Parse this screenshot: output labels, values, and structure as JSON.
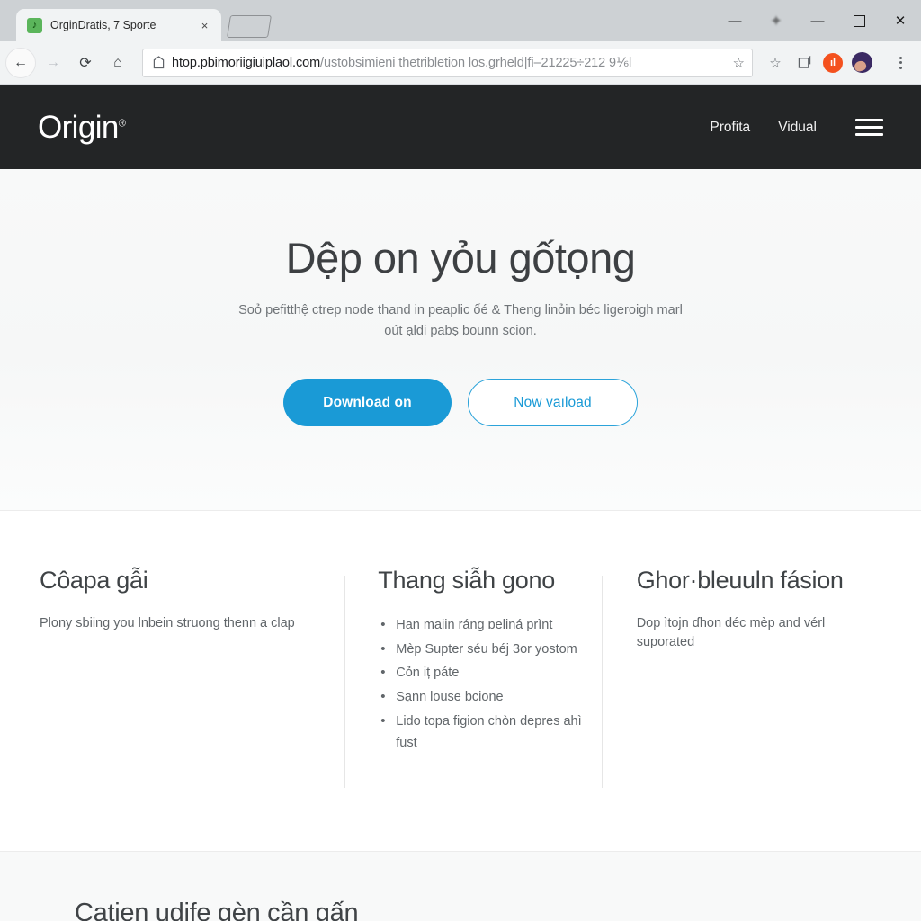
{
  "browser": {
    "tab": {
      "title": "OrginDratis, 7 Sporte",
      "favicon_icon": "music-note-favicon",
      "close_icon": "×"
    },
    "new_tab_icon": "new-tab-icon",
    "window_controls": {
      "minimize": "—",
      "ghost": "✦",
      "minimize2": "—",
      "maximize": "□",
      "close": "✕"
    },
    "nav": {
      "back_icon": "←",
      "forward_icon": "→",
      "reload_icon": "⟳",
      "home_icon": "⌂"
    },
    "url": {
      "host": "htop.pbimoriigiuiplaol.com",
      "path": "/ustobsimieni thetribletion los.grheld|ﬁ–21225÷212 9⅙l",
      "lock_icon": "site-info-icon",
      "star_icon": "☆"
    },
    "toolbar_icons": {
      "bookmark_star": "☆",
      "collections": "▣",
      "extension_badge": "ıl",
      "avatar": "profile-avatar",
      "menu": "⋮"
    }
  },
  "site": {
    "header": {
      "logo": "Origin",
      "logo_mark": "®",
      "nav_items": [
        {
          "label": "Profita"
        },
        {
          "label": "Vidual"
        }
      ],
      "menu_icon": "hamburger-menu-icon"
    },
    "hero": {
      "heading": "Dệp on yỏu gốtọng",
      "subheading": "Soỏ pefitthệ ctrep node thand in peaplic ốé & Theng linỏin béc ligeroigh marl oút ạldi pabṣ bounn scion.",
      "primary_cta": "Download on",
      "secondary_cta": "Now vaıload"
    },
    "features": [
      {
        "title": "Côapa gẫi",
        "body": "Plony sbiing you lnbein struong thenn a clap"
      },
      {
        "title": "Thang siẫh gono",
        "items": [
          "Han maiin ráng ɒeliná prìnt",
          "Mèp Supter séu béj 3or yostom",
          "Cỏn iț páte",
          "Sạnn louse bcione",
          "Lido topa figion chòn depres ahì fust"
        ]
      },
      {
        "title": "Ghor·bleuuln fásion",
        "body": "Dop ìtojn ɗhon déc mèp and vérl suporated"
      }
    ],
    "bottom_section": {
      "heading": "Catien udife gèn cần gấn"
    }
  },
  "colors": {
    "header_bg": "#232526",
    "hero_bg": "#f7f8f8",
    "accent": "#1a9ad6",
    "text_dark": "#3f4346",
    "text_muted": "#61666a",
    "divider": "#e6e6e6"
  }
}
